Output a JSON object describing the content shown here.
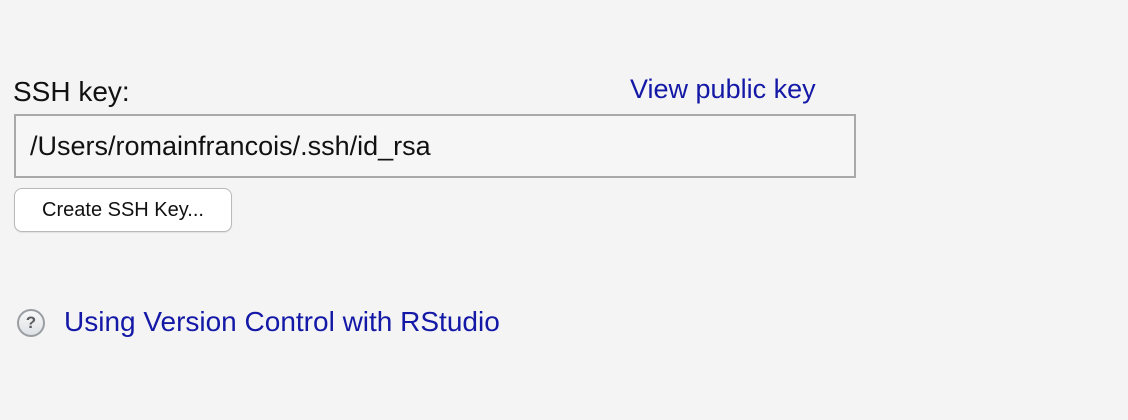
{
  "ssh": {
    "label": "SSH key:",
    "view_public_key_link": "View public key",
    "key_path": "/Users/romainfrancois/.ssh/id_rsa",
    "create_button": "Create SSH Key..."
  },
  "help": {
    "icon_name": "help-question-icon",
    "icon_glyph": "?",
    "link_text": "Using Version Control with RStudio"
  },
  "colors": {
    "link": "#1418a6",
    "background": "#f3f4f3"
  }
}
